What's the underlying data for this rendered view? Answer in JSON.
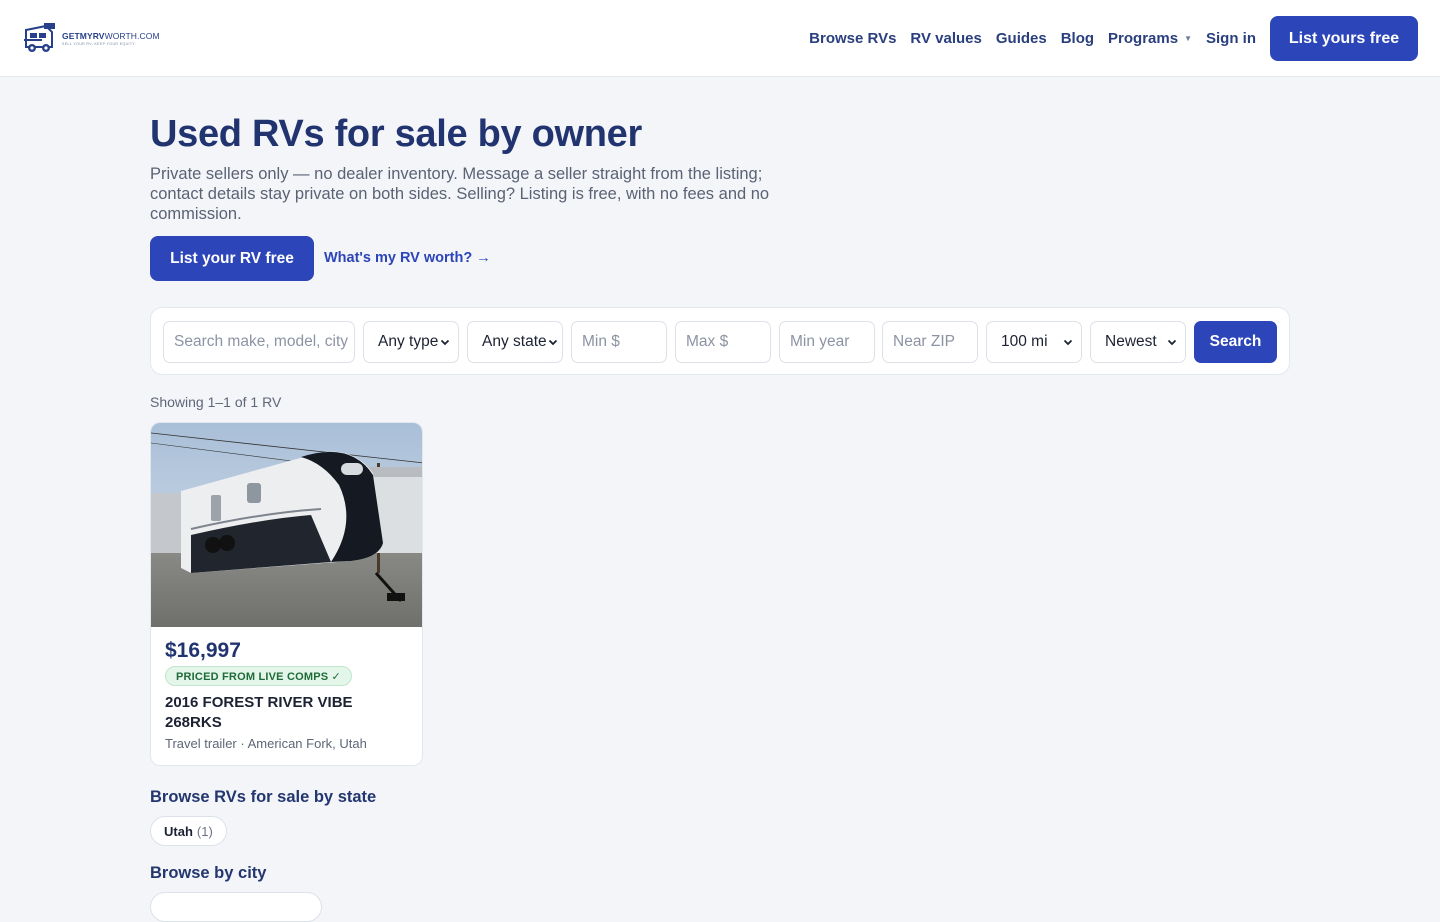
{
  "header": {
    "logo_name_bold": "GETMYRV",
    "logo_name_light": "WORTH.COM",
    "logo_tagline": "SELL YOUR RV. KEEP YOUR EQUITY.",
    "nav": [
      {
        "label": "Browse RVs"
      },
      {
        "label": "RV values"
      },
      {
        "label": "Guides"
      },
      {
        "label": "Blog"
      },
      {
        "label": "Programs"
      },
      {
        "label": "Sign in"
      }
    ],
    "cta": "List yours free"
  },
  "hero": {
    "title": "Used RVs for sale by owner",
    "subtitle": "Private sellers only — no dealer inventory. Message a seller straight from the listing; contact details stay private on both sides. Selling? Listing is free, with no fees and no commission.",
    "primary_button": "List your RV free",
    "secondary_link": "What's my RV worth? →"
  },
  "filters": {
    "search_placeholder": "Search make, model, city",
    "type_value": "Any type",
    "state_value": "Any state",
    "min_price_placeholder": "Min $",
    "max_price_placeholder": "Max $",
    "min_year_placeholder": "Min year",
    "zip_placeholder": "Near ZIP",
    "radius_value": "100 mi",
    "sort_value": "Newest",
    "search_button": "Search"
  },
  "results": {
    "showing": "Showing 1–1 of 1 RV",
    "listings": [
      {
        "price": "$16,997",
        "badge": "PRICED FROM LIVE COMPS ✓",
        "title": "2016 FOREST RIVER VIBE 268RKS",
        "rv_type": "Travel trailer",
        "location": "American Fork, Utah"
      }
    ]
  },
  "browse_state": {
    "title": "Browse RVs for sale by state",
    "chips": [
      {
        "name": "Utah",
        "count": "(1)"
      }
    ]
  },
  "browse_city": {
    "title": "Browse by city"
  },
  "colors": {
    "brand": "#2c45b8",
    "heading": "#21346f",
    "badge_bg": "#e3f6e9",
    "badge_text": "#1f6b39",
    "page_bg": "#f3f5f9"
  }
}
